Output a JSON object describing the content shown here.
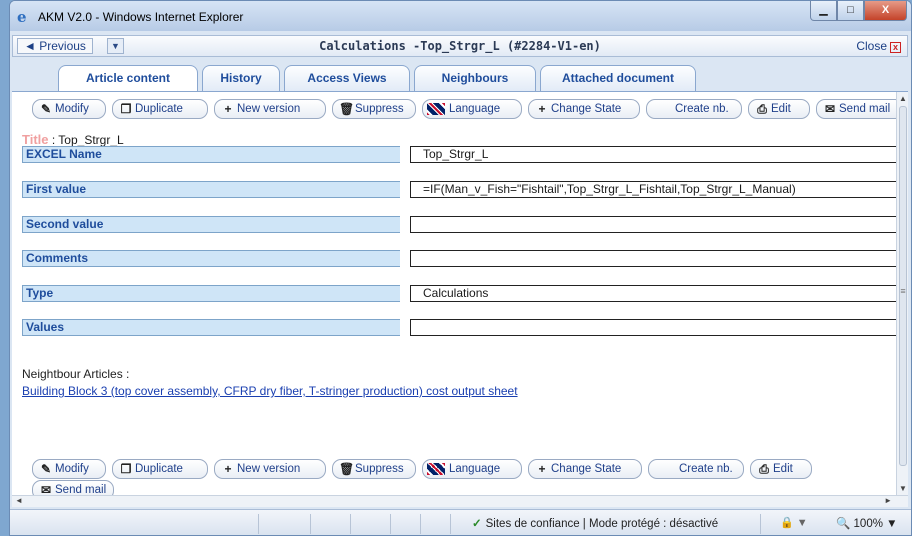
{
  "window": {
    "title": "AKM V2.0 - Windows Internet Explorer",
    "min_glyph": "▁",
    "max_glyph": "□",
    "close_glyph": "X"
  },
  "navbar": {
    "previous_label": "Previous",
    "previous_arrow": "◄",
    "dropdown_glyph": "▼",
    "document_title": "Calculations -Top_Strgr_L (#2284-V1-en)",
    "close_label": "Close",
    "close_glyph": "x"
  },
  "tabs": [
    {
      "label": "Article content",
      "active": true
    },
    {
      "label": "History",
      "active": false
    },
    {
      "label": "Access Views",
      "active": false
    },
    {
      "label": "Neighbours",
      "active": false
    },
    {
      "label": "Attached document",
      "active": false
    }
  ],
  "toolbar": {
    "modify": "Modify",
    "duplicate": "Duplicate",
    "new_version": "New version",
    "suppress": "Suppress",
    "language": "Language",
    "change_state": "Change State",
    "create_nb": "Create nb.",
    "edit": "Edit",
    "send_mail": "Send mail"
  },
  "toolbar_icons": {
    "modify": "pencil-icon",
    "duplicate": "duplicate-icon",
    "new_version": "plus-icon",
    "suppress": "trash-icon",
    "language": "uk-flag-icon",
    "change_state": "plus-icon",
    "edit": "printer-icon",
    "send_mail": "envelope-icon"
  },
  "glyphs": {
    "pencil": "✎",
    "duplicate": "❐",
    "plus": "+",
    "trash": "🗑",
    "printer": "⎙",
    "envelope": "✉",
    "check": "✓",
    "lock": "🔒",
    "zoom": "🔍",
    "grip": "≡",
    "up": "▲",
    "down": "▼",
    "left": "◄",
    "right": "►"
  },
  "article": {
    "title_label": "Title",
    "title_value": ": Top_Strgr_L",
    "fields": [
      {
        "label": "EXCEL Name",
        "value": "Top_Strgr_L"
      },
      {
        "label": "First value",
        "value": "=IF(Man_v_Fish=\"Fishtail\",Top_Strgr_L_Fishtail,Top_Strgr_L_Manual)"
      },
      {
        "label": "Second value",
        "value": ""
      },
      {
        "label": "Comments",
        "value": ""
      },
      {
        "label": "Type",
        "value": "Calculations"
      },
      {
        "label": "Values",
        "value": ""
      }
    ]
  },
  "neighbours": {
    "heading": "Neightbour Articles :",
    "link": "Building Block 3 (top cover assembly, CFRP dry fiber, T-stringer production) cost output sheet"
  },
  "statusbar": {
    "zone_text": "Sites de confiance | Mode protégé : désactivé",
    "zoom_text": "100%",
    "zoom_arrow": "▼",
    "lock_arrow": "▼"
  },
  "colors": {
    "accent": "#1f4d9c",
    "label_bg": "#cfe5f7",
    "link": "#1a3fb0"
  }
}
